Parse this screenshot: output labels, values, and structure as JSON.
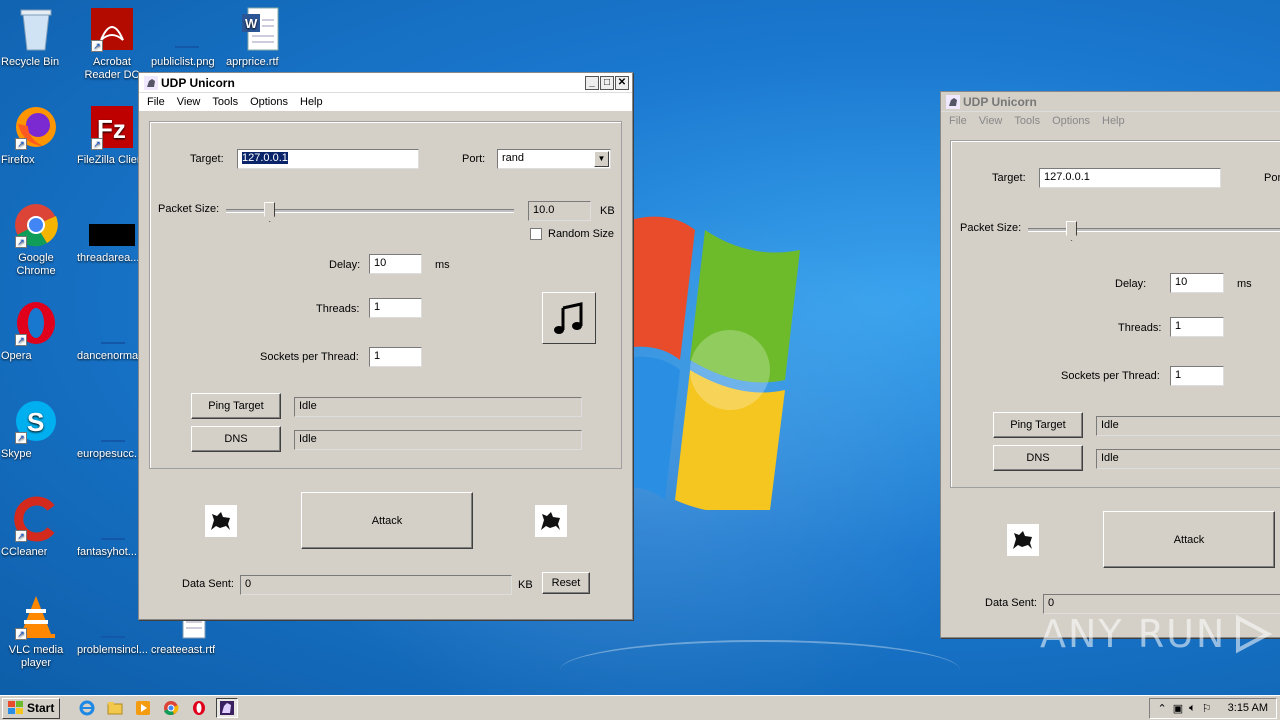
{
  "desktop": {
    "icons": [
      {
        "label": "Recycle Bin",
        "icon": "recycle-bin-icon"
      },
      {
        "label": "Acrobat Reader DC",
        "icon": "acrobat-icon"
      },
      {
        "label": "publiclist.png",
        "icon": "image-file-icon"
      },
      {
        "label": "aprprice.rtf",
        "icon": "word-document-icon"
      },
      {
        "label": "Firefox",
        "icon": "firefox-icon"
      },
      {
        "label": "FileZilla Client",
        "icon": "filezilla-icon"
      },
      {
        "label": "Google Chrome",
        "icon": "chrome-icon"
      },
      {
        "label": "threadarea...",
        "icon": "black-file-icon"
      },
      {
        "label": "Opera",
        "icon": "opera-icon"
      },
      {
        "label": "dancenorma...",
        "icon": "file-icon"
      },
      {
        "label": "Skype",
        "icon": "skype-icon"
      },
      {
        "label": "europesucc...",
        "icon": "file-icon"
      },
      {
        "label": "CCleaner",
        "icon": "ccleaner-icon"
      },
      {
        "label": "fantasyhot...",
        "icon": "file-icon"
      },
      {
        "label": "VLC media player",
        "icon": "vlc-icon"
      },
      {
        "label": "problemsincl...",
        "icon": "file-icon"
      },
      {
        "label": "createeast.rtf",
        "icon": "rtf-file-icon"
      }
    ]
  },
  "window_main": {
    "title": "UDP Unicorn",
    "menu": [
      "File",
      "View",
      "Tools",
      "Options",
      "Help"
    ],
    "target_label": "Target:",
    "target_value": "127.0.0.1",
    "port_label": "Port:",
    "port_value": "rand",
    "packet_size_label": "Packet Size:",
    "packet_size_value": "10.0",
    "packet_size_unit": "KB",
    "packet_size_slider_fraction": 0.15,
    "random_size_label": "Random Size",
    "random_size_checked": false,
    "delay_label": "Delay:",
    "delay_value": "10",
    "delay_unit": "ms",
    "threads_label": "Threads:",
    "threads_value": "1",
    "sockets_label": "Sockets per Thread:",
    "sockets_value": "1",
    "ping_button": "Ping Target",
    "ping_status": "Idle",
    "dns_button": "DNS",
    "dns_status": "Idle",
    "attack_button": "Attack",
    "data_sent_label": "Data Sent:",
    "data_sent_value": "0",
    "data_sent_unit": "KB",
    "reset_button": "Reset"
  },
  "window_second": {
    "title": "UDP Unicorn",
    "menu": [
      "File",
      "View",
      "Tools",
      "Options",
      "Help"
    ],
    "target_label": "Target:",
    "target_value": "127.0.0.1",
    "port_label_partial": "Por",
    "packet_size_label": "Packet Size:",
    "delay_label": "Delay:",
    "delay_value": "10",
    "delay_unit": "ms",
    "threads_label": "Threads:",
    "threads_value": "1",
    "sockets_label": "Sockets per Thread:",
    "sockets_value": "1",
    "ping_button": "Ping Target",
    "ping_status": "Idle",
    "dns_button": "DNS",
    "dns_status": "Idle",
    "attack_button": "Attack",
    "data_sent_label": "Data Sent:",
    "data_sent_value": "0"
  },
  "taskbar": {
    "start_label": "Start",
    "clock": "3:15 AM"
  },
  "watermark": "ANY RUN"
}
